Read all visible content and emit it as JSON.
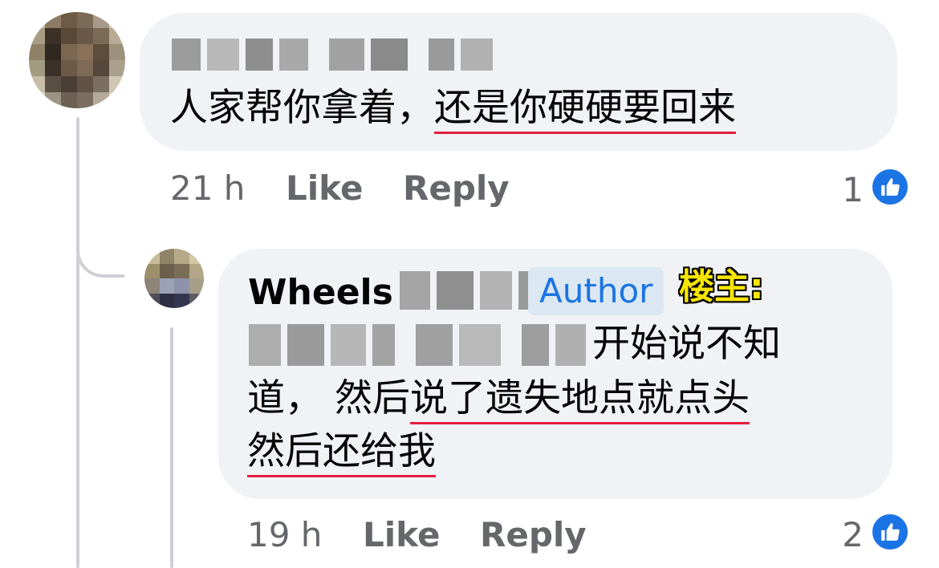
{
  "comments": [
    {
      "text_plain": "人家帮你拿着，",
      "text_underlined": "还是你硬硬要回来",
      "meta": {
        "time": "21 h",
        "like": "Like",
        "reply": "Reply"
      },
      "reactions": {
        "count": "1",
        "icon": "thumbs-up-icon"
      }
    }
  ],
  "reply": {
    "author": "Wheels",
    "badge": "Author",
    "op_label": "楼主:",
    "line1": "开始说不知",
    "line2_plain": "道， 然后",
    "line2_underlined": "说了遗失地点就点头",
    "line3_underlined": "然后还给我",
    "meta": {
      "time": "19 h",
      "like": "Like",
      "reply": "Reply"
    },
    "reactions": {
      "count": "2",
      "icon": "thumbs-up-icon"
    }
  },
  "colors": {
    "bubble_bg": "#f0f2f5",
    "underline": "#e41e3f",
    "meta_text": "#65676b",
    "badge_bg": "#dbe7f2",
    "badge_text": "#1b74e4",
    "op_label": "#f7e500",
    "like_blue": "#1b74e4"
  }
}
